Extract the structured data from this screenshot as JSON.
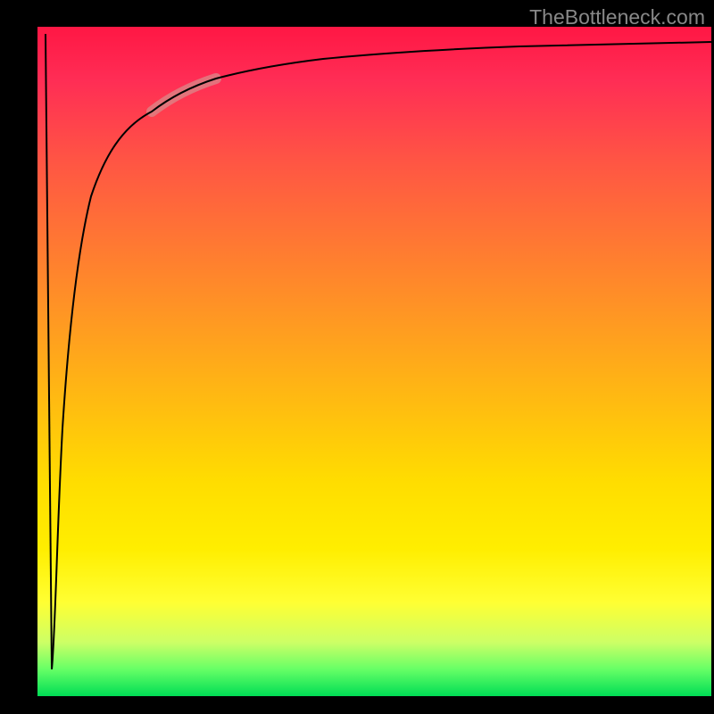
{
  "watermark": "TheBottleneck.com",
  "chart_data": {
    "type": "line",
    "title": "",
    "xlabel": "",
    "ylabel": "",
    "x": [
      0,
      0.02,
      0.025,
      0.03,
      0.04,
      0.05,
      0.06,
      0.08,
      0.1,
      0.12,
      0.15,
      0.18,
      0.22,
      0.26,
      0.3,
      0.35,
      0.4,
      0.5,
      0.6,
      0.7,
      0.8,
      0.9,
      1.0
    ],
    "values": [
      0.98,
      0.04,
      0.08,
      0.2,
      0.4,
      0.55,
      0.65,
      0.75,
      0.8,
      0.83,
      0.86,
      0.88,
      0.9,
      0.915,
      0.925,
      0.935,
      0.94,
      0.95,
      0.955,
      0.96,
      0.963,
      0.965,
      0.967
    ],
    "xlim": [
      0,
      1
    ],
    "ylim": [
      0,
      1
    ],
    "highlight_range": {
      "x_start": 0.16,
      "x_end": 0.26
    },
    "background": "gradient-red-yellow-green",
    "series_color": "#000000",
    "legend": false,
    "grid": false
  }
}
